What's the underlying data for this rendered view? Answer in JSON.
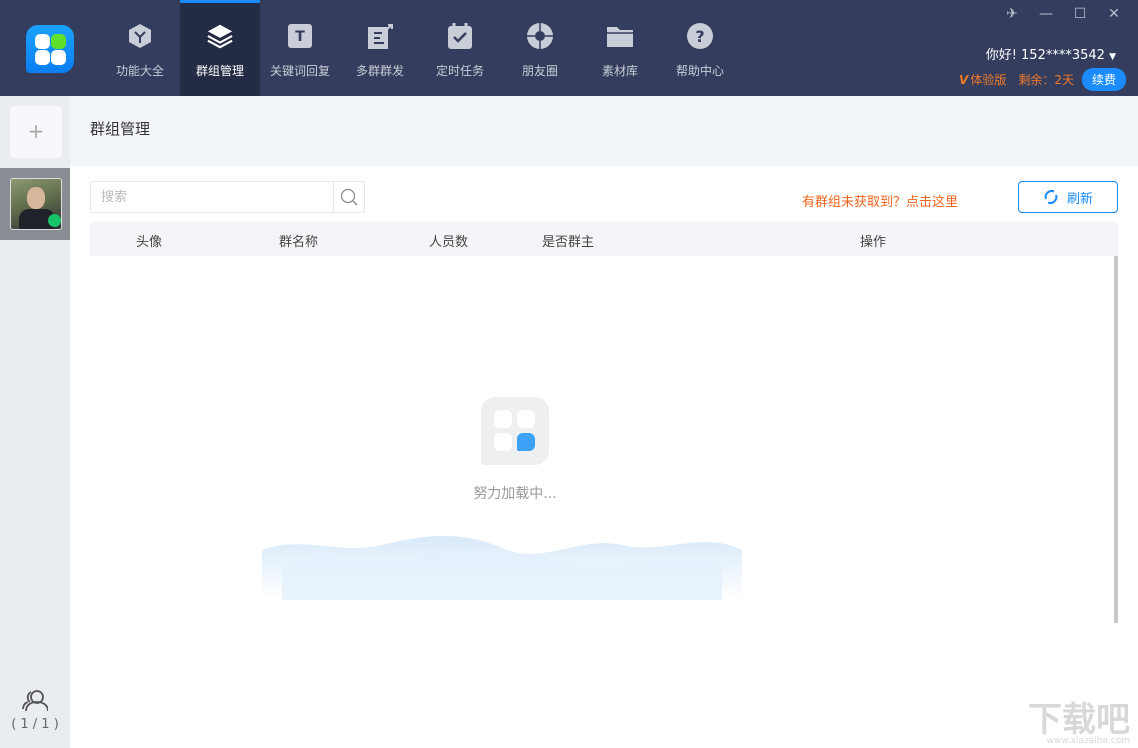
{
  "nav": [
    {
      "label": "功能大全",
      "icon": "cube-icon"
    },
    {
      "label": "群组管理",
      "icon": "layers-icon",
      "active": true
    },
    {
      "label": "关键词回复",
      "icon": "text-t-icon"
    },
    {
      "label": "多群群发",
      "icon": "share-doc-icon"
    },
    {
      "label": "定时任务",
      "icon": "calendar-check-icon"
    },
    {
      "label": "朋友圈",
      "icon": "aperture-icon"
    },
    {
      "label": "素材库",
      "icon": "folder-icon"
    },
    {
      "label": "帮助中心",
      "icon": "help-icon"
    }
  ],
  "user": {
    "greeting": "你好! 152****3542",
    "edition": "体验版",
    "remaining": "剩余：2天",
    "renew": "续费"
  },
  "sidebar": {
    "add": "+",
    "count": "( 1 / 1 )"
  },
  "page": {
    "title": "群组管理",
    "search_placeholder": "搜索",
    "hint": "有群组未获取到？点击这里",
    "refresh": "刷新"
  },
  "table": {
    "columns": [
      "头像",
      "群名称",
      "人员数",
      "是否群主",
      "操作"
    ]
  },
  "loading": "努力加载中...",
  "watermark": {
    "main": "下载吧",
    "sub": "www.xiazaiba.com"
  },
  "colors": {
    "accent": "#1a8cff",
    "topbar": "#343d5d",
    "warning": "#f0641e"
  }
}
